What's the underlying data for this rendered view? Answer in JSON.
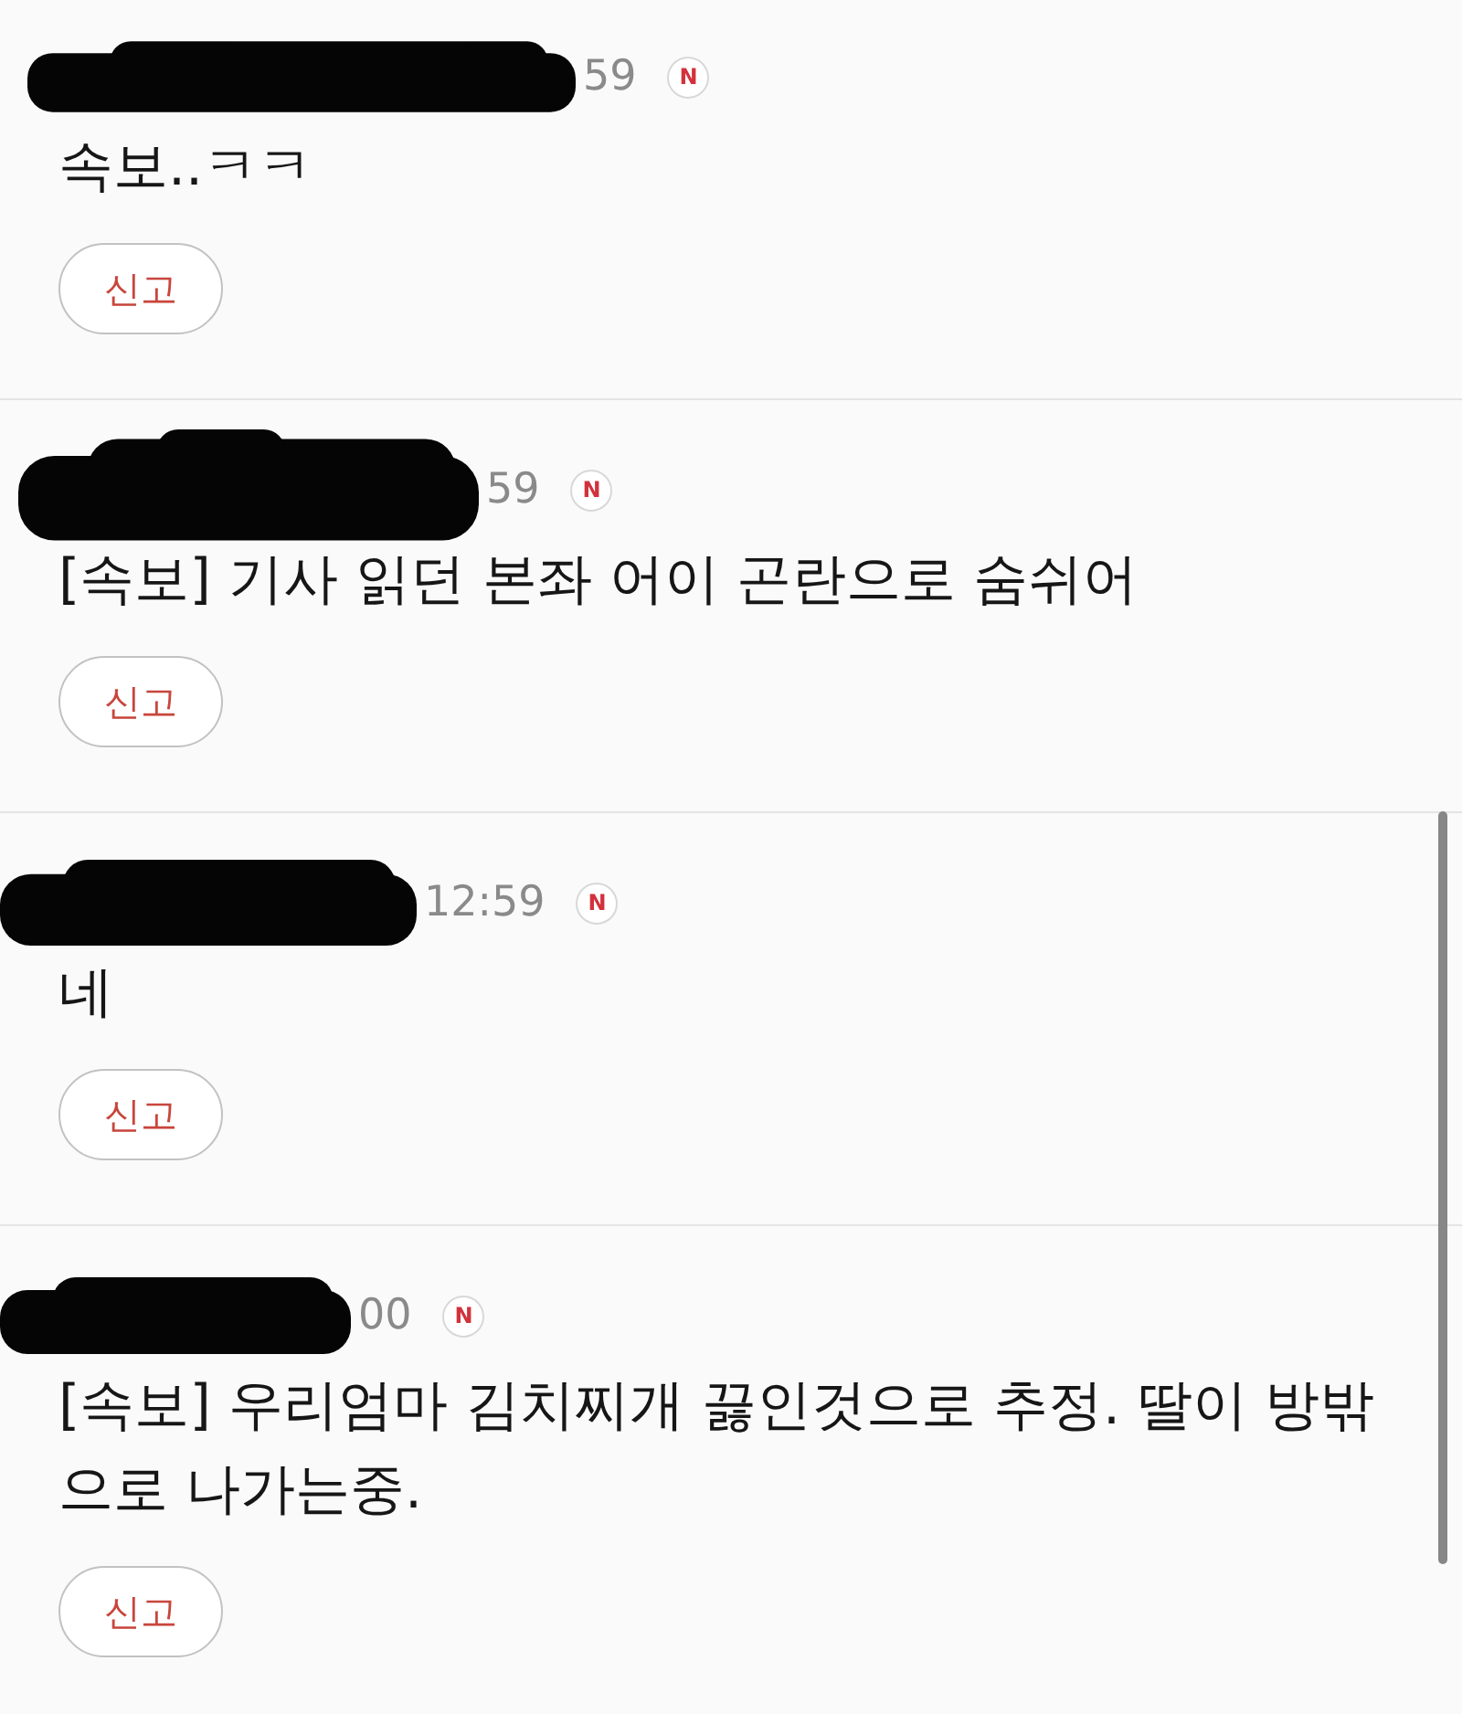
{
  "comments": [
    {
      "redacted": true,
      "time": "59",
      "badge": "N",
      "body": "속보..ㅋㅋ",
      "report_button": "신고"
    },
    {
      "redacted": true,
      "time": "59",
      "badge": "N",
      "body": "[속보] 기사 읽던 본좌 어이 곤란으로 숨쉬어",
      "report_button": "신고"
    },
    {
      "redacted": true,
      "time": "12:59",
      "badge": "N",
      "body": "네",
      "report_button": "신고"
    },
    {
      "redacted": true,
      "time": "00",
      "badge": "N",
      "body": "[속보] 우리엄마 김치찌개 끓인것으로 추정. 딸이 방밖으로 나가는중.",
      "report_button": "신고"
    }
  ]
}
